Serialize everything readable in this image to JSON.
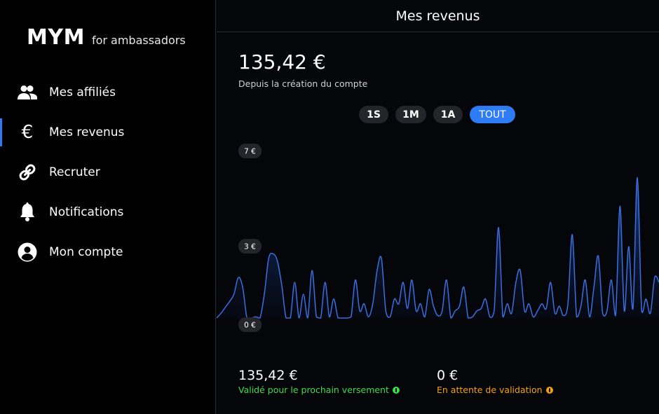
{
  "brand": {
    "main": "MYM",
    "sub": "for ambassadors"
  },
  "nav": [
    {
      "label": "Mes affiliés",
      "icon": "users-icon",
      "active": false
    },
    {
      "label": "Mes revenus",
      "icon": "euro-icon",
      "active": true
    },
    {
      "label": "Recruter",
      "icon": "link-icon",
      "active": false
    },
    {
      "label": "Notifications",
      "icon": "bell-icon",
      "active": false
    },
    {
      "label": "Mon compte",
      "icon": "account-circle-icon",
      "active": false
    }
  ],
  "header": {
    "title": "Mes revenus"
  },
  "summary": {
    "total": "135,42 €",
    "caption": "Depuis la création du compte"
  },
  "periods": [
    {
      "label": "1S",
      "active": false
    },
    {
      "label": "1M",
      "active": false
    },
    {
      "label": "1A",
      "active": false
    },
    {
      "label": "TOUT",
      "active": true
    }
  ],
  "stats": {
    "validated": {
      "value": "135,42 €",
      "caption": "Validé pour le prochain versement",
      "color": "#3ddc4b"
    },
    "pending": {
      "value": "0 €",
      "caption": "En attente de validation",
      "color": "#f5a10a"
    }
  },
  "colors": {
    "accent": "#2d7cf6",
    "line": "#3b6fe0"
  },
  "chart_data": {
    "type": "area",
    "y_tick_labels": [
      "7 €",
      "3 €",
      "0 €"
    ],
    "y_ticks": [
      7,
      3,
      0
    ],
    "ylim": [
      0,
      7
    ],
    "grid": false,
    "values": [
      0.0,
      0.2,
      0.45,
      0.7,
      1.0,
      1.7,
      1.3,
      0.0,
      0.0,
      0.05,
      0.0,
      1.0,
      2.5,
      2.7,
      2.4,
      1.4,
      0.0,
      0.0,
      1.5,
      0.0,
      1.0,
      0.0,
      2.0,
      0.05,
      0.0,
      1.5,
      0.05,
      0.8,
      0.0,
      0.0,
      0.0,
      0.05,
      1.6,
      0.3,
      0.6,
      0.05,
      0.6,
      2.0,
      2.5,
      0.3,
      0.05,
      0.8,
      0.6,
      1.5,
      0.4,
      1.6,
      0.3,
      0.6,
      0.05,
      1.2,
      0.5,
      0.1,
      0.3,
      1.6,
      0.0,
      0.3,
      0.5,
      1.3,
      0.0,
      0.05,
      0.3,
      0.4,
      0.8,
      0.05,
      0.3,
      3.8,
      0.05,
      0.6,
      0.2,
      1.5,
      2.0,
      0.3,
      0.6,
      0.05,
      0.3,
      0.6,
      0.4,
      1.5,
      0.2,
      0.5,
      0.1,
      0.6,
      3.5,
      0.05,
      0.5,
      1.6,
      0.05,
      1.3,
      2.6,
      0.2,
      0.3,
      1.6,
      0.1,
      4.7,
      0.3,
      3.0,
      0.4,
      5.9,
      0.3,
      0.8,
      0.2,
      1.7,
      1.5
    ]
  }
}
